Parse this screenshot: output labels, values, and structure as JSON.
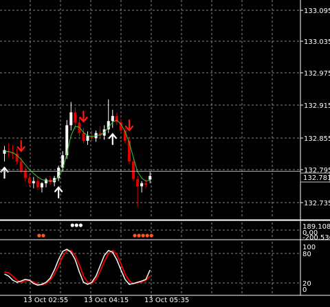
{
  "chart_data": {
    "type": "candlestick",
    "price_axis": {
      "ticks": [
        "133.095",
        "133.035",
        "132.975",
        "132.915",
        "132.855",
        "132.795",
        "132.735"
      ],
      "range": [
        132.69,
        133.112
      ]
    },
    "current_price": "132.781",
    "time_labels": [
      "13 Oct 02:55",
      "13 Oct 04:15",
      "13 Oct 05:35"
    ],
    "candles": [
      {
        "o": 132.815,
        "h": 132.83,
        "l": 132.8,
        "c": 132.822
      },
      {
        "o": 132.82,
        "h": 132.835,
        "l": 132.808,
        "c": 132.818
      },
      {
        "o": 132.818,
        "h": 132.832,
        "l": 132.805,
        "c": 132.815
      },
      {
        "o": 132.815,
        "h": 132.825,
        "l": 132.795,
        "c": 132.8
      },
      {
        "o": 132.8,
        "h": 132.808,
        "l": 132.778,
        "c": 132.782
      },
      {
        "o": 132.782,
        "h": 132.79,
        "l": 132.762,
        "c": 132.768
      },
      {
        "o": 132.768,
        "h": 132.775,
        "l": 132.752,
        "c": 132.758
      },
      {
        "o": 132.758,
        "h": 132.77,
        "l": 132.748,
        "c": 132.762
      },
      {
        "o": 132.762,
        "h": 132.77,
        "l": 132.745,
        "c": 132.75
      },
      {
        "o": 132.75,
        "h": 132.76,
        "l": 132.74,
        "c": 132.758
      },
      {
        "o": 132.758,
        "h": 132.768,
        "l": 132.75,
        "c": 132.765
      },
      {
        "o": 132.765,
        "h": 132.772,
        "l": 132.755,
        "c": 132.76
      },
      {
        "o": 132.76,
        "h": 132.772,
        "l": 132.752,
        "c": 132.768
      },
      {
        "o": 132.768,
        "h": 132.792,
        "l": 132.762,
        "c": 132.788
      },
      {
        "o": 132.788,
        "h": 132.82,
        "l": 132.78,
        "c": 132.812
      },
      {
        "o": 132.812,
        "h": 132.88,
        "l": 132.805,
        "c": 132.87
      },
      {
        "o": 132.87,
        "h": 132.915,
        "l": 132.86,
        "c": 132.895
      },
      {
        "o": 132.895,
        "h": 132.905,
        "l": 132.862,
        "c": 132.875
      },
      {
        "o": 132.875,
        "h": 132.885,
        "l": 132.848,
        "c": 132.855
      },
      {
        "o": 132.855,
        "h": 132.865,
        "l": 132.835,
        "c": 132.84
      },
      {
        "o": 132.84,
        "h": 132.858,
        "l": 132.832,
        "c": 132.85
      },
      {
        "o": 132.85,
        "h": 132.86,
        "l": 132.84,
        "c": 132.845
      },
      {
        "o": 132.845,
        "h": 132.86,
        "l": 132.838,
        "c": 132.855
      },
      {
        "o": 132.855,
        "h": 132.868,
        "l": 132.845,
        "c": 132.85
      },
      {
        "o": 132.85,
        "h": 132.87,
        "l": 132.842,
        "c": 132.862
      },
      {
        "o": 132.862,
        "h": 132.92,
        "l": 132.855,
        "c": 132.878
      },
      {
        "o": 132.878,
        "h": 132.9,
        "l": 132.865,
        "c": 132.888
      },
      {
        "o": 132.888,
        "h": 132.895,
        "l": 132.87,
        "c": 132.876
      },
      {
        "o": 132.876,
        "h": 132.882,
        "l": 132.855,
        "c": 132.86
      },
      {
        "o": 132.86,
        "h": 132.866,
        "l": 132.835,
        "c": 132.84
      },
      {
        "o": 132.84,
        "h": 132.848,
        "l": 132.795,
        "c": 132.8
      },
      {
        "o": 132.8,
        "h": 132.806,
        "l": 132.762,
        "c": 132.766
      },
      {
        "o": 132.766,
        "h": 132.772,
        "l": 132.712,
        "c": 132.752
      },
      {
        "o": 132.752,
        "h": 132.762,
        "l": 132.74,
        "c": 132.758
      },
      {
        "o": 132.758,
        "h": 132.766,
        "l": 132.748,
        "c": 132.755
      },
      {
        "o": 132.765,
        "h": 132.78,
        "l": 132.758,
        "c": 132.772
      }
    ],
    "moving_average": [
      132.82,
      132.819,
      132.817,
      132.812,
      132.804,
      132.794,
      132.784,
      132.777,
      132.77,
      132.765,
      132.763,
      132.762,
      132.763,
      132.77,
      132.785,
      132.815,
      132.85,
      132.868,
      132.866,
      132.856,
      132.85,
      132.848,
      132.85,
      132.851,
      132.856,
      132.866,
      132.876,
      132.88,
      132.872,
      132.858,
      132.836,
      132.808,
      132.78,
      132.768,
      132.762,
      132.764
    ],
    "signal_arrows": [
      {
        "bar": 0,
        "dir": "up",
        "color": "#ffffff"
      },
      {
        "bar": 4,
        "dir": "down",
        "color": "#ff1a1a"
      },
      {
        "bar": 13,
        "dir": "up",
        "color": "#ffffff"
      },
      {
        "bar": 19,
        "dir": "down",
        "color": "#ff1a1a"
      },
      {
        "bar": 26,
        "dir": "up",
        "color": "#ffffff"
      },
      {
        "bar": 30,
        "dir": "down",
        "color": "#ff1a1a"
      }
    ],
    "indicator1": {
      "labels": [
        "189.1083",
        "0.00",
        "-200.536"
      ],
      "white_dots": [
        16,
        17,
        18
      ],
      "orange_dots": [
        8,
        9,
        31,
        32,
        33,
        34,
        35
      ]
    },
    "stochastic": {
      "labels": [
        "100",
        "80",
        "20",
        "0"
      ],
      "range": [
        0,
        100
      ],
      "main": [
        35,
        30,
        20,
        15,
        18,
        22,
        20,
        12,
        8,
        10,
        15,
        25,
        45,
        70,
        90,
        95,
        88,
        70,
        40,
        15,
        10,
        15,
        30,
        55,
        80,
        92,
        88,
        70,
        45,
        22,
        10,
        12,
        15,
        18,
        22,
        45
      ],
      "signal": [
        40,
        38,
        30,
        20,
        15,
        18,
        20,
        16,
        10,
        9,
        12,
        20,
        35,
        55,
        78,
        92,
        92,
        80,
        58,
        30,
        15,
        12,
        22,
        42,
        65,
        85,
        92,
        82,
        60,
        35,
        18,
        12,
        14,
        16,
        20,
        30
      ]
    },
    "colors": {
      "bull": "#ffffff",
      "bear": "#e00000",
      "ma": "#33cc33",
      "stoch_main": "#ffffff",
      "stoch_signal": "#e00000",
      "dots_white": "#ffffff",
      "dots_orange": "#ff5a1e",
      "grid": "#8a8a8a"
    }
  }
}
